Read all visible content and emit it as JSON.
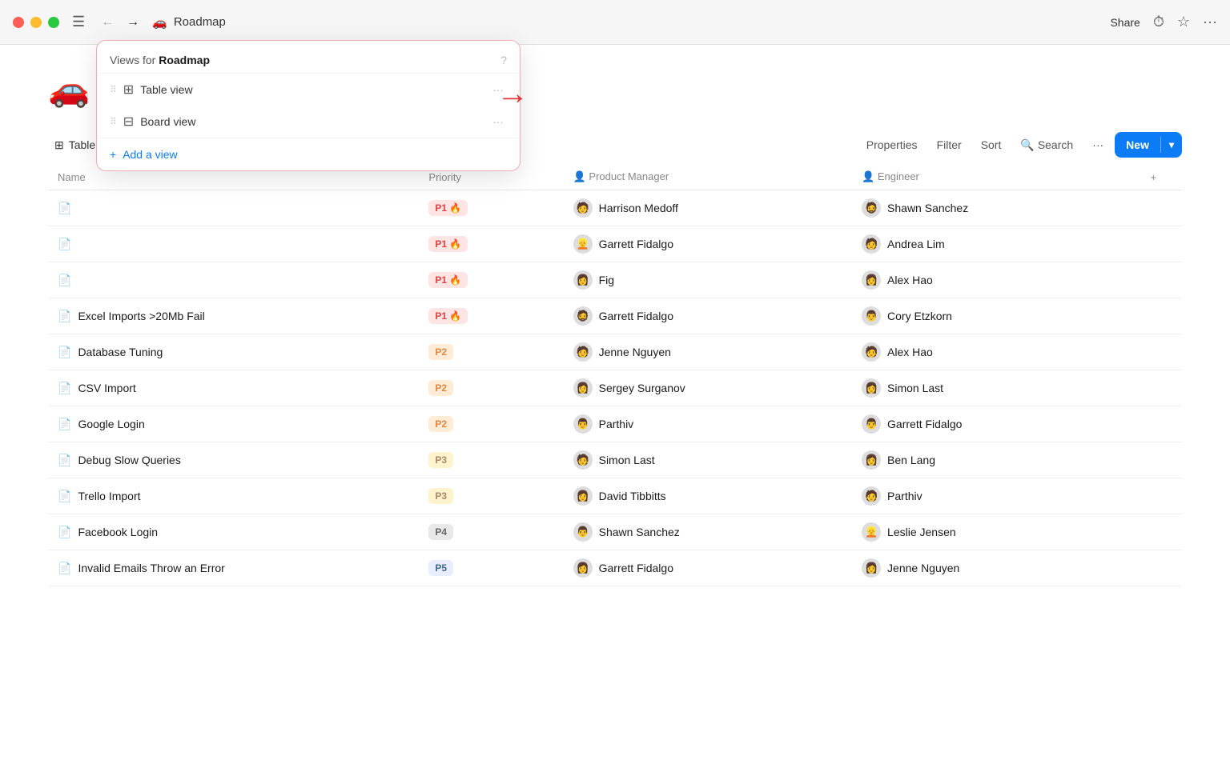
{
  "titlebar": {
    "title": "Roadmap",
    "emoji": "🚗",
    "share_label": "Share",
    "menu_icon": "☰",
    "back_arrow": "←",
    "forward_arrow": "→",
    "history_icon": "⏱",
    "star_icon": "☆",
    "more_icon": "···"
  },
  "toolbar": {
    "view_label": "Table view",
    "properties_label": "Properties",
    "filter_label": "Filter",
    "sort_label": "Sort",
    "search_label": "Search",
    "more_icon": "···",
    "new_label": "New",
    "chevron_down": "▾"
  },
  "dropdown": {
    "title_prefix": "Views for ",
    "title_bold": "Roadmap",
    "help_icon": "?",
    "views": [
      {
        "label": "Table view",
        "icon": "⊞"
      },
      {
        "label": "Board view",
        "icon": "⊟"
      }
    ],
    "add_view_label": "Add a view",
    "add_icon": "+"
  },
  "table": {
    "columns": [
      {
        "label": "Name"
      },
      {
        "label": "Priority"
      },
      {
        "label": "Product Manager"
      },
      {
        "label": "Engineer"
      }
    ],
    "rows": [
      {
        "name": "",
        "priority": "P1 🔥",
        "priority_class": "p1",
        "pm_avatar": "👤",
        "pm": "Harrison Medoff",
        "eng_avatar": "👤",
        "eng": "Shawn Sanchez"
      },
      {
        "name": "",
        "priority": "P1 🔥",
        "priority_class": "p1",
        "pm_avatar": "👤",
        "pm": "Garrett Fidalgo",
        "eng_avatar": "👤",
        "eng": "Andrea Lim"
      },
      {
        "name": "",
        "priority": "P1 🔥",
        "priority_class": "p1",
        "pm_avatar": "👤",
        "pm": "Fig",
        "eng_avatar": "👤",
        "eng": "Alex Hao"
      },
      {
        "name": "Excel Imports >20Mb Fail",
        "priority": "P1 🔥",
        "priority_class": "p1",
        "pm_avatar": "👤",
        "pm": "Garrett Fidalgo",
        "eng_avatar": "👤",
        "eng": "Cory Etzkorn"
      },
      {
        "name": "Database Tuning",
        "priority": "P2",
        "priority_class": "p2",
        "pm_avatar": "👤",
        "pm": "Jenne Nguyen",
        "eng_avatar": "👤",
        "eng": "Alex Hao"
      },
      {
        "name": "CSV Import",
        "priority": "P2",
        "priority_class": "p2",
        "pm_avatar": "👤",
        "pm": "Sergey Surganov",
        "eng_avatar": "👤",
        "eng": "Simon Last"
      },
      {
        "name": "Google Login",
        "priority": "P2",
        "priority_class": "p2",
        "pm_avatar": "👤",
        "pm": "Parthiv",
        "eng_avatar": "👤",
        "eng": "Garrett Fidalgo"
      },
      {
        "name": "Debug Slow Queries",
        "priority": "P3",
        "priority_class": "p3",
        "pm_avatar": "👤",
        "pm": "Simon Last",
        "eng_avatar": "👤",
        "eng": "Ben Lang"
      },
      {
        "name": "Trello Import",
        "priority": "P3",
        "priority_class": "p3",
        "pm_avatar": "👤",
        "pm": "David Tibbitts",
        "eng_avatar": "👤",
        "eng": "Parthiv"
      },
      {
        "name": "Facebook Login",
        "priority": "P4",
        "priority_class": "p4",
        "pm_avatar": "👤",
        "pm": "Shawn Sanchez",
        "eng_avatar": "👤",
        "eng": "Leslie Jensen"
      },
      {
        "name": "Invalid Emails Throw an Error",
        "priority": "P5",
        "priority_class": "p5",
        "pm_avatar": "👤",
        "pm": "Garrett Fidalgo",
        "eng_avatar": "👤",
        "eng": "Jenne Nguyen"
      }
    ]
  },
  "page": {
    "emoji": "🚗",
    "title": "Roadmap"
  }
}
